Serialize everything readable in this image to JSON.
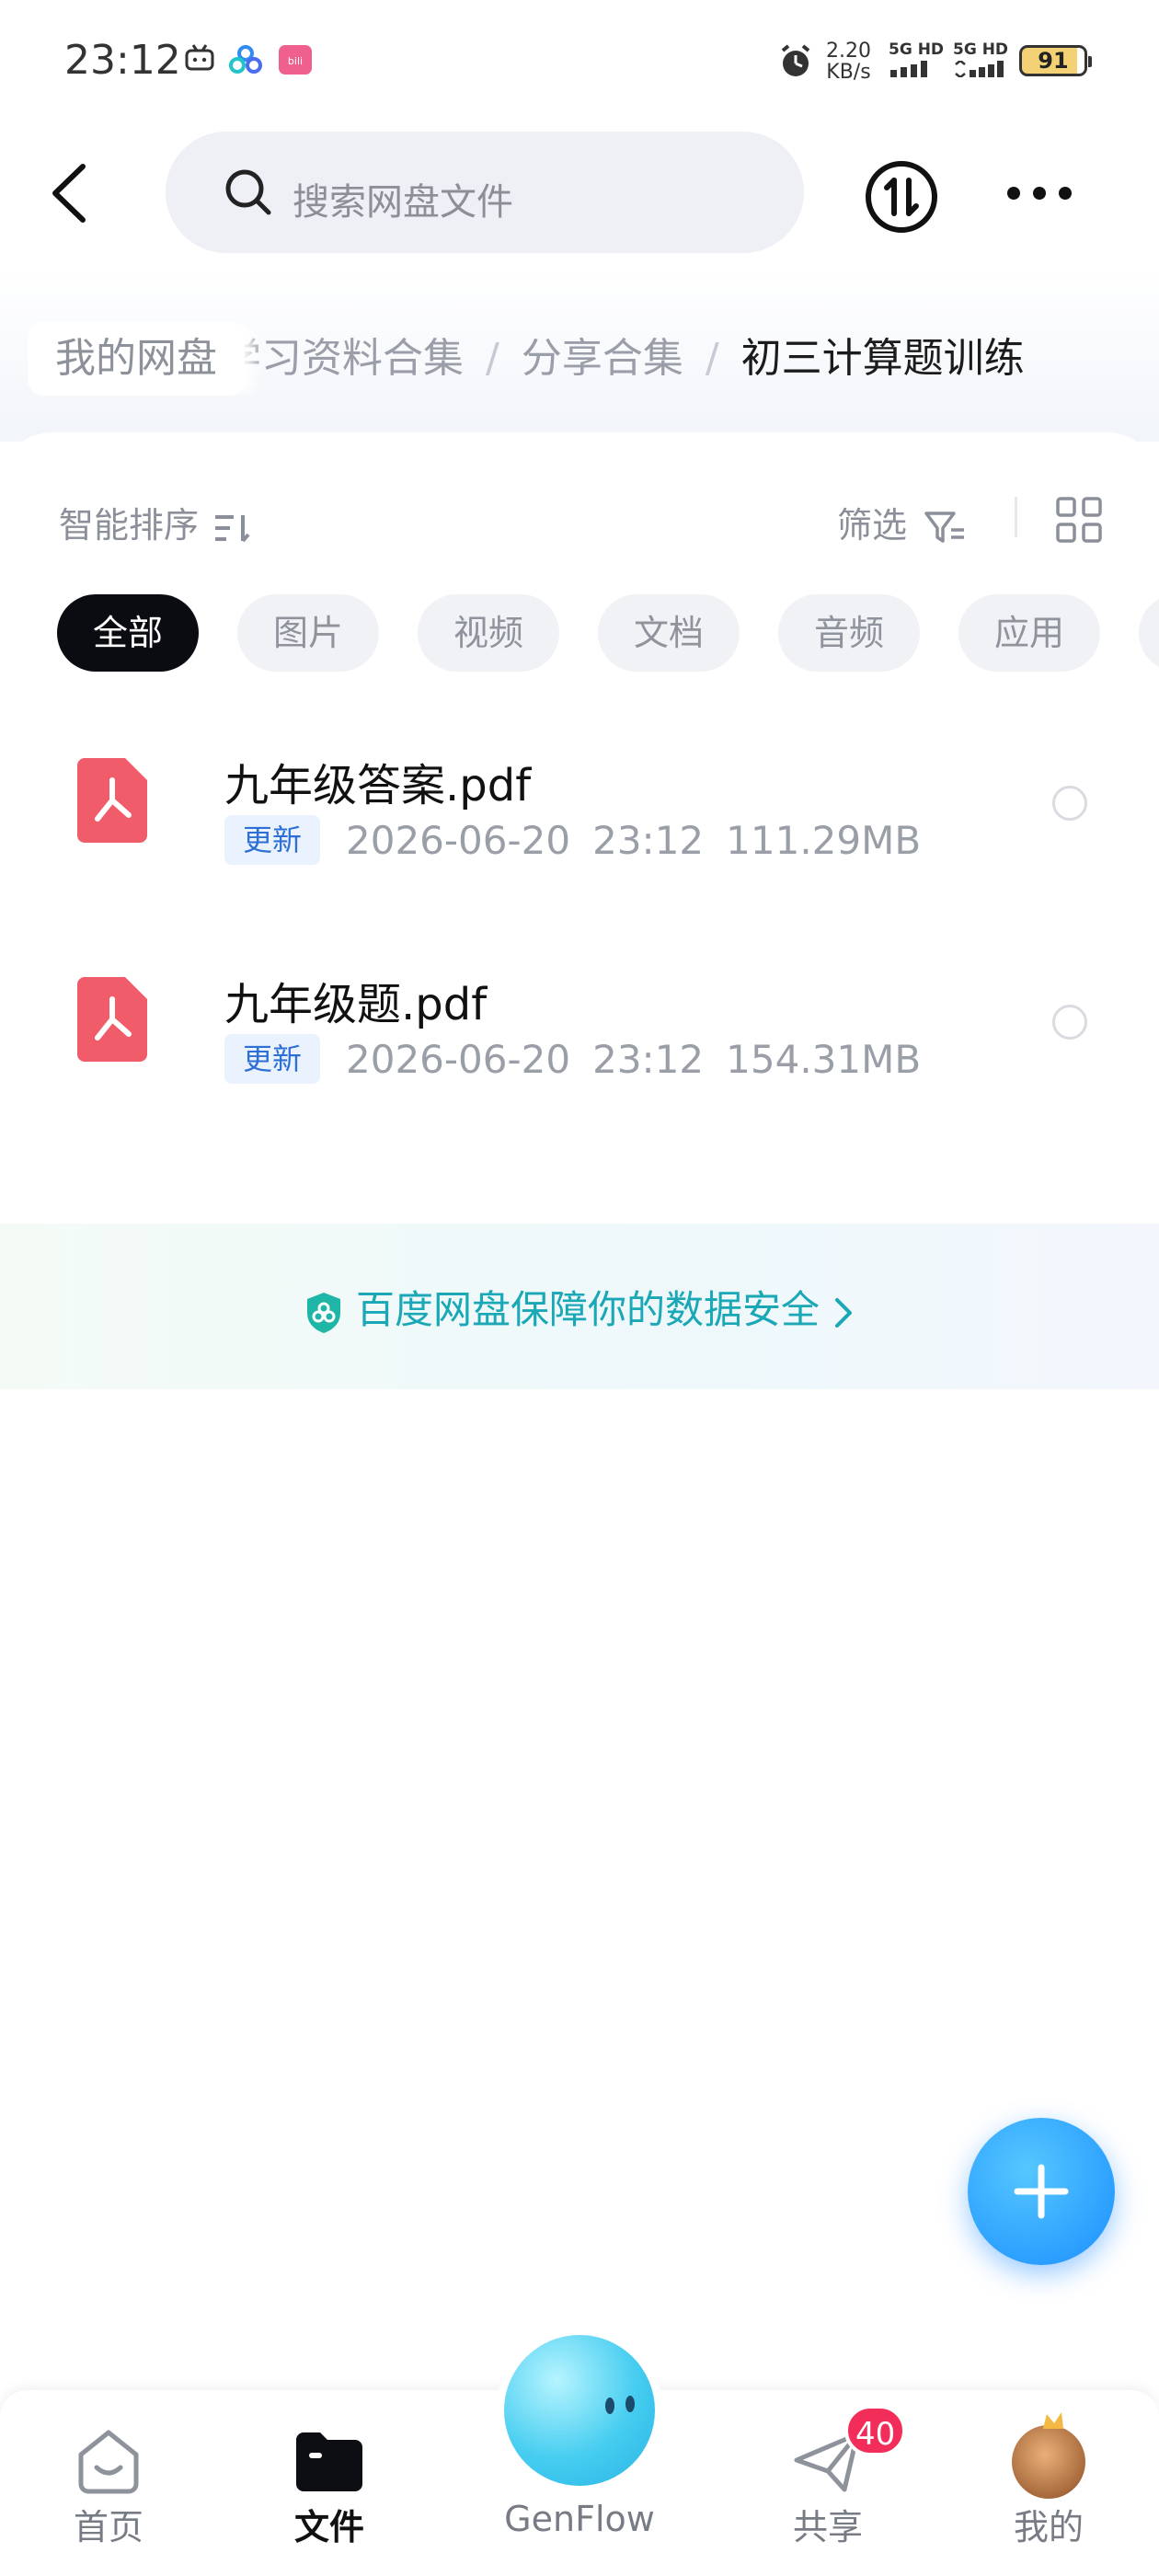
{
  "status_bar": {
    "time": "23:12",
    "network_speed_value": "2.20",
    "network_speed_unit": "KB/s",
    "sim1_label": "5G HD",
    "sim2_label": "5G HD",
    "battery": "91",
    "icons": [
      "bilibili-tv-icon",
      "baidu-netdisk-icon",
      "bilibili-app-icon",
      "alarm-icon"
    ]
  },
  "header": {
    "search_placeholder": "搜索网盘文件",
    "icons": [
      "back-icon",
      "search-icon",
      "transfer-icon",
      "more-icon"
    ]
  },
  "breadcrumb": {
    "root": "我的网盘",
    "items": [
      "学习资料合集",
      "分享合集"
    ],
    "current": "初三计算题训练"
  },
  "toolbar": {
    "sort_label": "智能排序",
    "filter_label": "筛选"
  },
  "categories": [
    "全部",
    "图片",
    "视频",
    "文档",
    "音频",
    "应用"
  ],
  "files": [
    {
      "name": "九年级答案.pdf",
      "tag": "更新",
      "date": "2026-06-20",
      "time": "23:12",
      "size": "111.29MB",
      "icon": "pdf-icon"
    },
    {
      "name": "九年级题.pdf",
      "tag": "更新",
      "date": "2026-06-20",
      "time": "23:12",
      "size": "154.31MB",
      "icon": "pdf-icon"
    }
  ],
  "security_notice": "百度网盘保障你的数据安全",
  "bottom_nav": [
    {
      "label": "首页",
      "icon": "home-icon"
    },
    {
      "label": "文件",
      "icon": "folder-icon",
      "active": true
    },
    {
      "label": "GenFlow",
      "icon": "genflow-icon"
    },
    {
      "label": "共享",
      "icon": "share-plane-icon",
      "badge": "40"
    },
    {
      "label": "我的",
      "icon": "avatar-icon"
    }
  ],
  "colors": {
    "accent": "#1b8fff",
    "security_text": "#1aa7b6",
    "badge": "#f32d5a",
    "pdf_icon": "#f05c6a",
    "active_chip": "#0b0b12"
  }
}
